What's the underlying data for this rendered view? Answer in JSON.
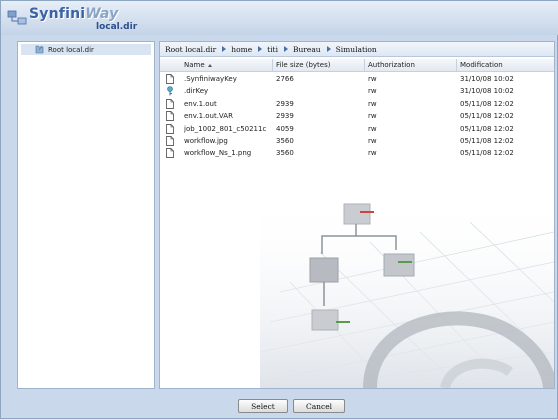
{
  "header": {
    "brand_main": "Synfini",
    "brand_way": "Way",
    "location": "local.dir"
  },
  "tree": {
    "root_label": "Root local.dir"
  },
  "breadcrumb": [
    "Root local.dir",
    "home",
    "titi",
    "Bureau",
    "Simulation"
  ],
  "table": {
    "columns": [
      "Name",
      "File size (bytes)",
      "Authorization",
      "Modification"
    ],
    "sorted_column": "Name",
    "rows": [
      {
        "name": ".SynfiniwayKey",
        "size": "2766",
        "auth": "rw",
        "modified": "31/10/08 10:02",
        "icon": "document-icon"
      },
      {
        "name": ".dirKey",
        "size": "",
        "auth": "rw",
        "modified": "31/10/08 10:02",
        "icon": "key-icon"
      },
      {
        "name": "env.1.out",
        "size": "2939",
        "auth": "rw",
        "modified": "05/11/08 12:02",
        "icon": "document-icon"
      },
      {
        "name": "env.1.out.VAR",
        "size": "2939",
        "auth": "rw",
        "modified": "05/11/08 12:02",
        "icon": "document-icon"
      },
      {
        "name": "job_1002_801_c50211c",
        "size": "4059",
        "auth": "rw",
        "modified": "05/11/08 12:02",
        "icon": "document-icon"
      },
      {
        "name": "workflow.jpg",
        "size": "3560",
        "auth": "rw",
        "modified": "05/11/08 12:02",
        "icon": "document-icon"
      },
      {
        "name": "workflow_Ns_1.png",
        "size": "3560",
        "auth": "rw",
        "modified": "05/11/08 12:02",
        "icon": "document-icon"
      }
    ]
  },
  "buttons": {
    "select": "Select",
    "cancel": "Cancel"
  },
  "colors": {
    "accent": "#3a63a5",
    "frame": "#c9d8eb",
    "selected_row": "#d9e4f2"
  }
}
